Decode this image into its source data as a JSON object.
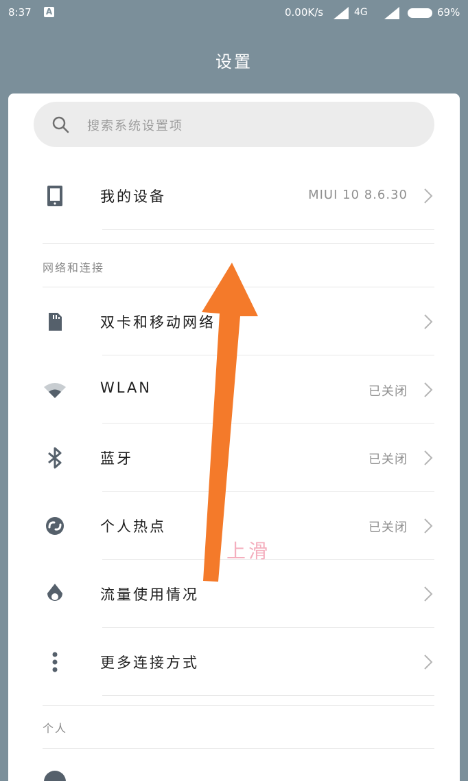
{
  "status_bar": {
    "time": "8:37",
    "app_icon": "A",
    "net_speed": "0.00K/s",
    "network": "4G",
    "battery_pct": "69%"
  },
  "header": {
    "title": "设置"
  },
  "search": {
    "placeholder": "搜索系统设置项",
    "icon": "search-icon"
  },
  "device": {
    "label": "我的设备",
    "value": "MIUI 10 8.6.30",
    "icon": "phone-icon"
  },
  "sections": {
    "network": "网络和连接",
    "personal": "个人"
  },
  "network_items": [
    {
      "label": "双卡和移动网络",
      "value": "",
      "icon": "sim-card-icon"
    },
    {
      "label": "WLAN",
      "value": "已关闭",
      "icon": "wifi-icon"
    },
    {
      "label": "蓝牙",
      "value": "已关闭",
      "icon": "bluetooth-icon"
    },
    {
      "label": "个人热点",
      "value": "已关闭",
      "icon": "hotspot-icon"
    },
    {
      "label": "流量使用情况",
      "value": "",
      "icon": "data-usage-icon"
    },
    {
      "label": "更多连接方式",
      "value": "",
      "icon": "more-vertical-icon"
    }
  ],
  "overlay": {
    "label": "上滑",
    "arrow_color": "#f47a2a"
  },
  "colors": {
    "background": "#7b8f9a",
    "icon": "#55606b",
    "accent_arrow": "#f47a2a"
  }
}
